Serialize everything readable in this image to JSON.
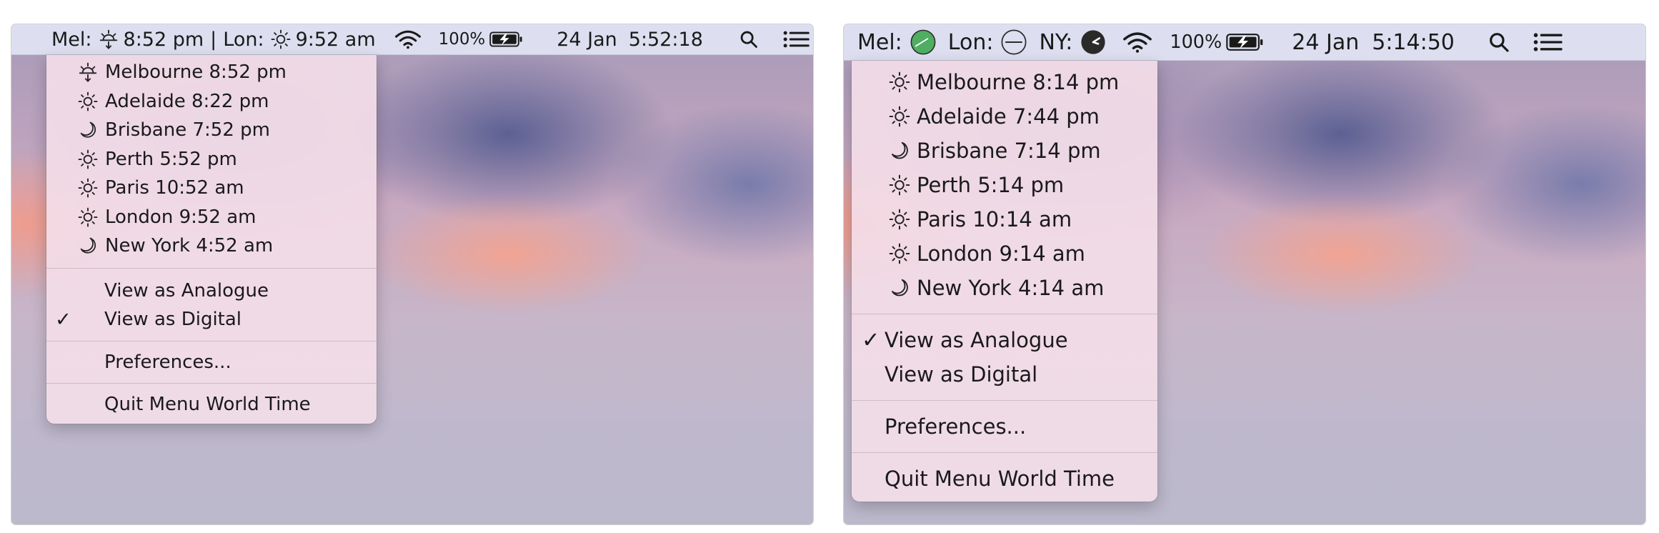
{
  "left_panel": {
    "menubar": {
      "mel_label": "Mel:",
      "mel_time": "8:52 pm",
      "divider": "|",
      "lon_label": "Lon:",
      "lon_time": "9:52 am",
      "battery_percent": "100%",
      "date": "24 Jan",
      "clock": "5:52:18"
    },
    "menu": {
      "cities": [
        {
          "text": "Melbourne 8:52 pm",
          "icon": "sunset-icon"
        },
        {
          "text": "Adelaide 8:22 pm",
          "icon": "sun-icon"
        },
        {
          "text": "Brisbane 7:52 pm",
          "icon": "moon-icon"
        },
        {
          "text": "Perth 5:52 pm",
          "icon": "sun-icon"
        },
        {
          "text": "Paris 10:52 am",
          "icon": "sun-icon"
        },
        {
          "text": "London 9:52 am",
          "icon": "sun-icon"
        },
        {
          "text": "New York 4:52 am",
          "icon": "moon-icon"
        }
      ],
      "view_analogue": "View as Analogue",
      "view_digital": "View as Digital",
      "checked_view": "digital",
      "check_mark": "✓",
      "preferences": "Preferences...",
      "quit": "Quit Menu World Time"
    }
  },
  "right_panel": {
    "menubar": {
      "mel_label": "Mel:",
      "lon_label": "Lon:",
      "ny_label": "NY:",
      "battery_percent": "100%",
      "date": "24 Jan",
      "clock": "5:14:50"
    },
    "menu": {
      "cities": [
        {
          "text": "Melbourne 8:14 pm",
          "icon": "sun-icon"
        },
        {
          "text": "Adelaide 7:44 pm",
          "icon": "sun-icon"
        },
        {
          "text": "Brisbane 7:14 pm",
          "icon": "moon-icon"
        },
        {
          "text": "Perth 5:14 pm",
          "icon": "sun-icon"
        },
        {
          "text": "Paris 10:14 am",
          "icon": "sun-icon"
        },
        {
          "text": "London 9:14 am",
          "icon": "sun-icon"
        },
        {
          "text": "New York 4:14 am",
          "icon": "moon-icon"
        }
      ],
      "view_analogue": "View as Analogue",
      "view_digital": "View as Digital",
      "checked_view": "analogue",
      "check_mark": "✓",
      "preferences": "Preferences...",
      "quit": "Quit Menu World Time"
    }
  },
  "colors": {
    "menubar_bg": "#e1e4f4",
    "menu_bg": "#f3dde8",
    "mel_clock_face": "#4fae62",
    "ny_clock_face": "#2a2a2a"
  }
}
